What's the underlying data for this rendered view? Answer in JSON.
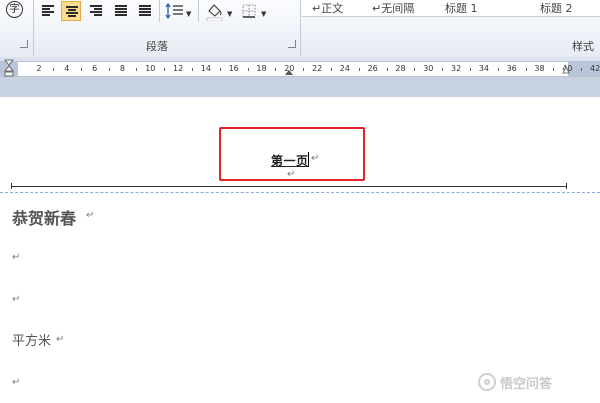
{
  "ribbon": {
    "paragraph_group_label": "段落",
    "styles_group_label": "样式",
    "phonetic_char": "字",
    "style_gallery": [
      "↵正文",
      "↵无间隔",
      "标题 1",
      "标题 2"
    ]
  },
  "ruler": {
    "ticks": [
      "2",
      "4",
      "6",
      "8",
      "10",
      "12",
      "14",
      "16",
      "18",
      "20",
      "22",
      "24",
      "26",
      "28",
      "30",
      "32",
      "34",
      "36",
      "38",
      "40",
      "42"
    ]
  },
  "document": {
    "header_text": "第一页",
    "paragraph_mark": "↵",
    "heading": "恭贺新春",
    "body_line": "平方米",
    "watermark": "悟空问答"
  },
  "colors": {
    "highlight_box": "#e3242b",
    "active_button": "#fbdc8a",
    "page_boundary": "#8eaad6"
  }
}
